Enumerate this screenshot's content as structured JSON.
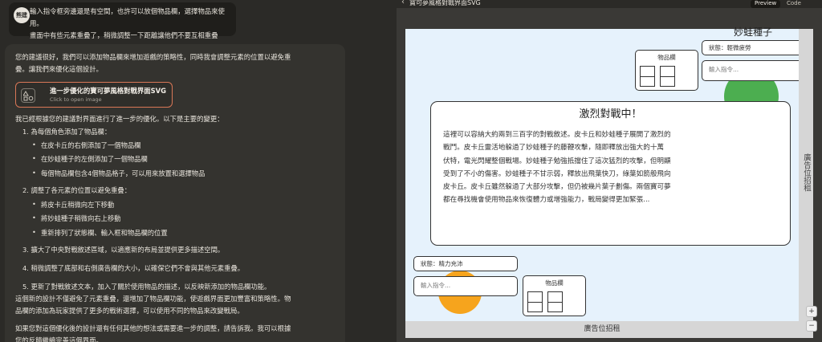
{
  "chat": {
    "user": {
      "avatar": "熊建",
      "lines": [
        "輸入指令框旁邊還是有空間，也許可以放個物品欄，選擇物品來使用。",
        "畫面中有些元素重疊了，稍微調整一下距離讓他們不要互相重疊"
      ]
    },
    "ai": {
      "intro": [
        "您的建議很好，我們可以添加物品欄來增加遊戲的策略性，同時我會調整元素的位置以避免重",
        "疊。讓我們來優化這個設計。"
      ],
      "artifact": {
        "title": "進一步優化的寶可夢風格對戰界面SVG",
        "subtitle": "Click to open image"
      },
      "changes_intro": "我已經根據您的建議對界面進行了進一步的優化。以下是主要的變更：",
      "items": [
        {
          "label": "1. 為每個角色添加了物品欄：",
          "subs": [
            "在皮卡丘的右側添加了一個物品欄",
            "在妙蛙種子的左側添加了一個物品欄",
            "每個物品欄包含4個物品格子，可以用來放置和選擇物品"
          ]
        },
        {
          "label": "2. 調整了各元素的位置以避免重疊：",
          "subs": [
            "將皮卡丘稍微向左下移動",
            "將妙蛙種子稍微向右上移動",
            "重新排列了狀態欄、輸入框和物品欄的位置"
          ]
        },
        {
          "label": "3. 擴大了中央對戰敘述區域，以適應新的布局並提供更多描述空間。",
          "subs": []
        },
        {
          "label": "4. 稍微調整了底部和右側廣告欄的大小，以確保它們不會與其他元素重疊。",
          "subs": []
        },
        {
          "label": "5. 更新了對戰敘述文本，加入了關於使用物品的描述，以反映新添加的物品欄功能。",
          "subs": []
        }
      ],
      "summary": [
        "這個新的設計不僅避免了元素重疊，還增加了物品欄功能，使遊戲界面更加豐富和策略性。物",
        "品欄的添加為玩家提供了更多的戰術選擇，可以使用不同的物品來改變戰局。"
      ],
      "closing": [
        "如果您對這個優化後的設計還有任何其他的想法或需要進一步的調整，請告訴我。我可以根據",
        "您的反饋繼續完善這個界面。"
      ]
    }
  },
  "panel": {
    "back_icon": "chevron-left-icon",
    "title": "寶可夢風格對戰界面SVG",
    "tabs": {
      "preview": "Preview",
      "code": "Code"
    }
  },
  "battle": {
    "enemy": {
      "name": "妙蛙種子",
      "status": "狀態：輕微疲勞",
      "input_placeholder": "輸入指令...",
      "inventory_title": "物品欄",
      "color": "#4cae50"
    },
    "player": {
      "status": "狀態：精力充沛",
      "input_placeholder": "輸入指令...",
      "inventory_title": "物品欄",
      "color": "#f6a41d"
    },
    "narration": {
      "title": "激烈對戰中！",
      "lines": [
        "這裡可以容納大約兩到三百字的對戰敘述。皮卡丘和妙蛙種子展開了激烈的",
        "戰鬥。皮卡丘靈活地躲過了妙蛙種子的藤鞭攻擊，隨即釋放出強大的十萬",
        "伏特，電光閃耀整個戰場。妙蛙種子勉強抵擋住了這次猛烈的攻擊，但明顯",
        "受到了不小的傷害。妙蛙種子不甘示弱，釋放出飛葉快刀，綠葉如箭般飛向",
        "皮卡丘。皮卡丘雖然躲過了大部分攻擊，但仍被幾片葉子劃傷。兩個寶可夢",
        "都在尋找機會使用物品來恢復體力或增強能力，戰局變得更加緊張..."
      ]
    },
    "ad_right": "廣告位招租",
    "ad_bottom": "廣告位招租"
  }
}
